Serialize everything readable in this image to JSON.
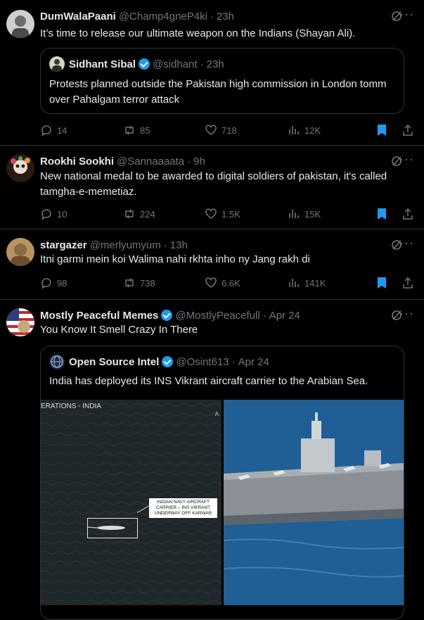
{
  "tweets": [
    {
      "name": "DumWalaPaani",
      "handle": "@Champ4gneP4ki",
      "time": "23h",
      "text": "It’s time to release our ultimate weapon on the Indians (Shayan Ali).",
      "quote": {
        "name": "Sidhant Sibal",
        "handle": "@sidhant",
        "time": "23h",
        "text": "Protests planned outside the Pakistan high commission in London tomm over Pahalgam terror attack"
      },
      "replies": "14",
      "reposts": "85",
      "likes": "718",
      "views": "12K"
    },
    {
      "name": "Rookhi Sookhi",
      "handle": "@Sannaaaata",
      "time": "9h",
      "text": "New national medal to be awarded to digital soldiers of pakistan, it's called tamgha-e-memetiaz.",
      "replies": "10",
      "reposts": "224",
      "likes": "1.5K",
      "views": "15K"
    },
    {
      "name": "stargazer",
      "handle": "@merlyumyum",
      "time": "13h",
      "text": "Itni garmi mein koi Walima nahi rkhta inho ny Jang rakh di",
      "replies": "98",
      "reposts": "738",
      "likes": "6.6K",
      "views": "141K"
    },
    {
      "name": "Mostly Peaceful Memes",
      "handle": "@MostlyPeacefull",
      "time": "Apr 24",
      "text": "You Know It Smell Crazy In There",
      "quote": {
        "name": "Open Source Intel",
        "handle": "@Osint613",
        "time": "Apr 24",
        "text": "India has deployed its INS Vikrant aircraft carrier to the Arabian Sea.",
        "media_caption": "ERATIONS - INDIA",
        "media_label": "INDIAN NAVY AIRCRAFT CARRIER – INS VIKRANT UNDERWAY OFF KARWAR",
        "media_corner": "A"
      }
    }
  ],
  "separator": "·",
  "more": "···",
  "icons": {
    "reply": "reply-icon",
    "repost": "repost-icon",
    "like": "heart-icon",
    "views": "views-icon",
    "bookmark": "bookmark-icon",
    "share": "share-icon",
    "grok": "grok-icon",
    "more": "more-icon"
  },
  "colors": {
    "accent": "#1d9bf0",
    "muted": "#71767b",
    "text": "#e7e9ea",
    "border": "#2f3336"
  }
}
